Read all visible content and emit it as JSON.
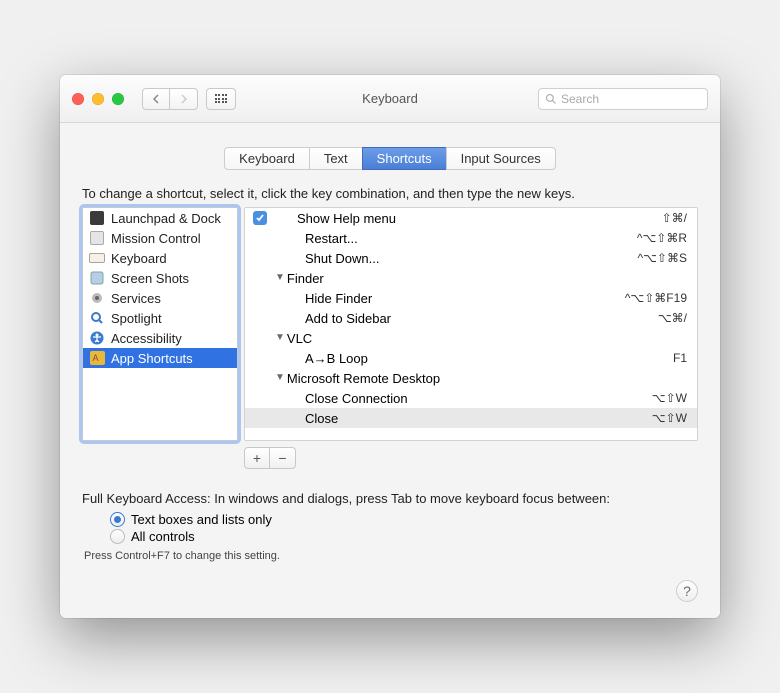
{
  "window": {
    "title": "Keyboard"
  },
  "search": {
    "placeholder": "Search"
  },
  "tabs": [
    {
      "label": "Keyboard",
      "active": false
    },
    {
      "label": "Text",
      "active": false
    },
    {
      "label": "Shortcuts",
      "active": true
    },
    {
      "label": "Input Sources",
      "active": false
    }
  ],
  "instruction": "To change a shortcut, select it, click the key combination, and then type the new keys.",
  "categories": [
    {
      "label": "Launchpad & Dock",
      "icon": "launchpad"
    },
    {
      "label": "Mission Control",
      "icon": "mcontrol"
    },
    {
      "label": "Keyboard",
      "icon": "keyboard"
    },
    {
      "label": "Screen Shots",
      "icon": "screen"
    },
    {
      "label": "Services",
      "icon": "gear"
    },
    {
      "label": "Spotlight",
      "icon": "spot"
    },
    {
      "label": "Accessibility",
      "icon": "acc"
    },
    {
      "label": "App Shortcuts",
      "icon": "app",
      "selected": true
    }
  ],
  "shortcuts": [
    {
      "kind": "top",
      "label": "Show Help menu",
      "keys": "⇧⌘/",
      "checked": true
    },
    {
      "kind": "item",
      "label": "Restart...",
      "keys": "^⌥⇧⌘R"
    },
    {
      "kind": "item",
      "label": "Shut Down...",
      "keys": "^⌥⇧⌘S"
    },
    {
      "kind": "group",
      "label": "Finder"
    },
    {
      "kind": "item",
      "label": "Hide Finder",
      "keys": "^⌥⇧⌘F19"
    },
    {
      "kind": "item",
      "label": "Add to Sidebar",
      "keys": "⌥⌘/"
    },
    {
      "kind": "group",
      "label": "VLC"
    },
    {
      "kind": "item",
      "label": "A→B Loop",
      "keys": "F1"
    },
    {
      "kind": "group",
      "label": "Microsoft Remote Desktop"
    },
    {
      "kind": "item",
      "label": "Close Connection",
      "keys": "⌥⇧W"
    },
    {
      "kind": "item",
      "label": "Close",
      "keys": "⌥⇧W",
      "selected": true
    }
  ],
  "fka": {
    "heading": "Full Keyboard Access: In windows and dialogs, press Tab to move keyboard focus between:",
    "options": [
      {
        "label": "Text boxes and lists only",
        "checked": true
      },
      {
        "label": "All controls",
        "checked": false
      }
    ],
    "hint": "Press Control+F7 to change this setting."
  }
}
